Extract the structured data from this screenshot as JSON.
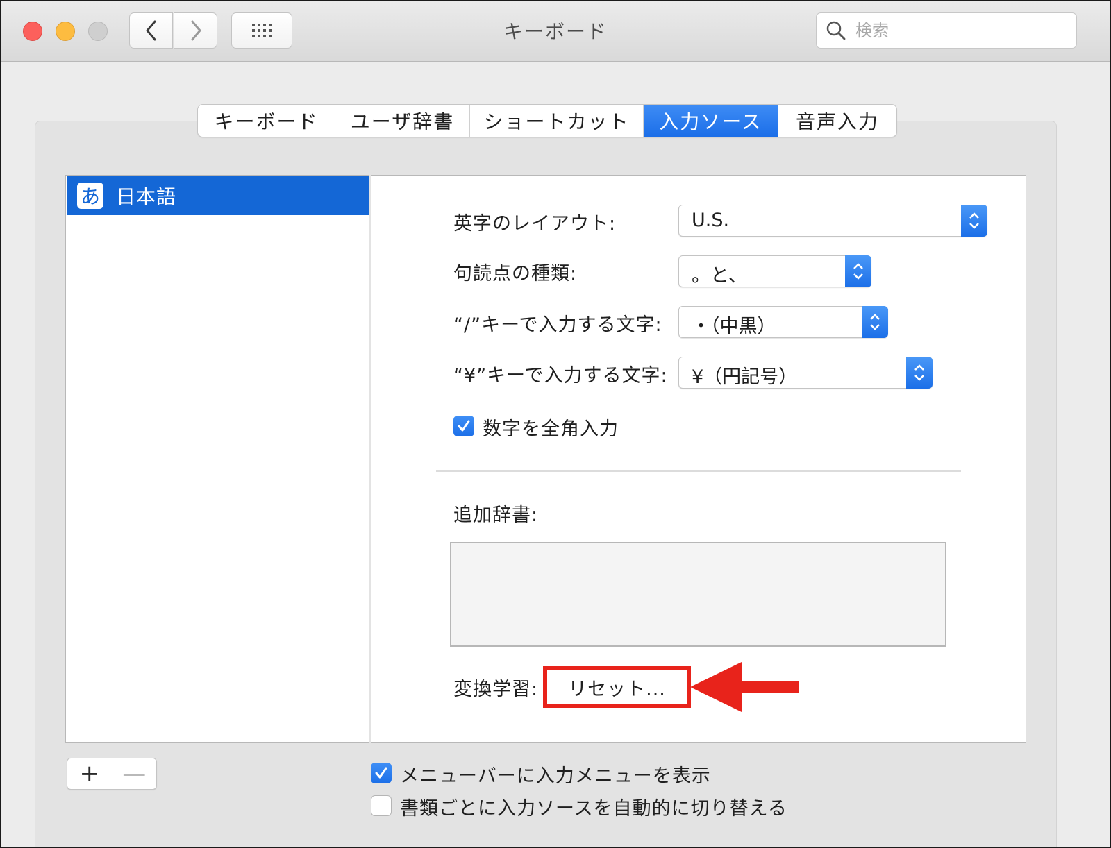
{
  "window": {
    "title": "キーボード",
    "search_placeholder": "検索"
  },
  "tabs": [
    {
      "label": "キーボード",
      "active": false
    },
    {
      "label": "ユーザ辞書",
      "active": false
    },
    {
      "label": "ショートカット",
      "active": false
    },
    {
      "label": "入力ソース",
      "active": true
    },
    {
      "label": "音声入力",
      "active": false
    }
  ],
  "sources": {
    "selected": {
      "icon_glyph": "あ",
      "label": "日本語"
    }
  },
  "settings": {
    "layout": {
      "label": "英字のレイアウト:",
      "value": "U.S."
    },
    "punctuation": {
      "label": "句読点の種類:",
      "value": "。と、"
    },
    "slash_key": {
      "label": "“/”キーで入力する文字:",
      "value": "・（中黒）"
    },
    "yen_key": {
      "label": "“¥”キーで入力する文字:",
      "value": "¥（円記号）"
    },
    "fullwidth_numbers": {
      "label": "数字を全角入力",
      "checked": true
    },
    "extra_dict_label": "追加辞書:",
    "learning": {
      "label": "変換学習:",
      "button": "リセット..."
    }
  },
  "bottom": {
    "plus": "+",
    "minus": "—",
    "show_menu": {
      "label": "メニューバーに入力メニューを表示",
      "checked": true
    },
    "auto_switch": {
      "label": "書類ごとに入力ソースを自動的に切り替える",
      "checked": false
    }
  },
  "colors": {
    "accent": "#1467d6",
    "annotation_red": "#e8231b"
  }
}
